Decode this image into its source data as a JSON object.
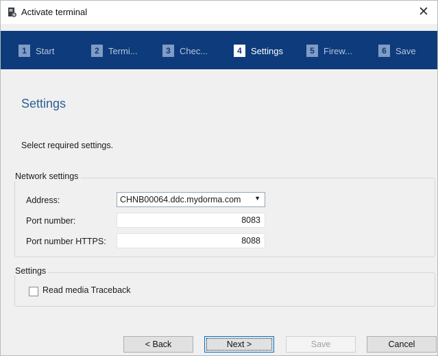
{
  "window": {
    "title": "Activate terminal",
    "close_glyph": "✕"
  },
  "steps": [
    {
      "num": "1",
      "label": "Start"
    },
    {
      "num": "2",
      "label": "Termi..."
    },
    {
      "num": "3",
      "label": "Chec..."
    },
    {
      "num": "4",
      "label": "Settings"
    },
    {
      "num": "5",
      "label": "Firew..."
    },
    {
      "num": "6",
      "label": "Save"
    }
  ],
  "active_step": 4,
  "page": {
    "heading": "Settings",
    "subtitle": "Select required settings."
  },
  "network": {
    "group_title": "Network settings",
    "address_label": "Address:",
    "address_value": "CHNB00064.ddc.mydorma.com",
    "port_label": "Port number:",
    "port_value": "8083",
    "https_label": "Port number HTTPS:",
    "https_value": "8088"
  },
  "settings_group": {
    "group_title": "Settings",
    "checkbox_label": "Read media Traceback",
    "checkbox_checked": false
  },
  "buttons": {
    "back": "< Back",
    "next": "Next >",
    "save": "Save",
    "cancel": "Cancel"
  },
  "colors": {
    "stepbar": "#0d3b7c",
    "heading": "#2c5f95"
  }
}
